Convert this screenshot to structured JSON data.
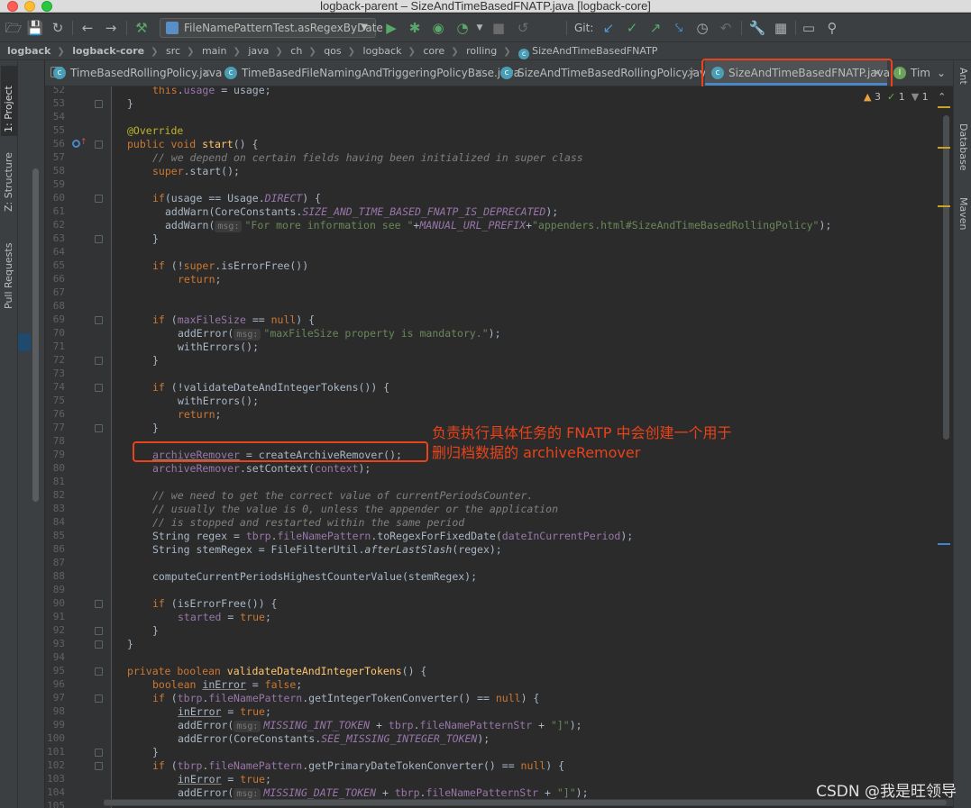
{
  "window": {
    "title": "logback-parent – SizeAndTimeBasedFNATP.java [logback-core]"
  },
  "toolbar": {
    "run_config": "FileNamePatternTest.asRegexByDate",
    "git_label": "Git:"
  },
  "breadcrumb": [
    "logback",
    "logback-core",
    "src",
    "main",
    "java",
    "ch",
    "qos",
    "logback",
    "core",
    "rolling",
    "SizeAndTimeBasedFNATP"
  ],
  "left_tools": {
    "project": "1: Project",
    "structure": "Z: Structure",
    "pull_requests": "Pull Requests"
  },
  "right_tools": {
    "ant": "Ant",
    "database": "Database",
    "maven": "Maven"
  },
  "tabs": [
    {
      "label": "TimeBasedRollingPolicy.java",
      "icon": "class-icon",
      "active": false
    },
    {
      "label": "TimeBasedFileNamingAndTriggeringPolicyBase.java",
      "icon": "class-icon",
      "active": false
    },
    {
      "label": "SizeAndTimeBasedRollingPolicy.java",
      "icon": "class-icon",
      "active": false
    },
    {
      "label": "SizeAndTimeBasedFNATP.java",
      "icon": "class-icon",
      "active": true
    },
    {
      "label": "Tim",
      "icon": "interface-icon",
      "active": false
    }
  ],
  "inspection": {
    "warnings": "3",
    "ok": "1",
    "other": "1"
  },
  "line_numbers": [
    "52",
    "53",
    "54",
    "55",
    "56",
    "57",
    "58",
    "59",
    "60",
    "61",
    "62",
    "63",
    "64",
    "65",
    "66",
    "67",
    "68",
    "69",
    "70",
    "71",
    "72",
    "73",
    "74",
    "75",
    "76",
    "77",
    "78",
    "79",
    "80",
    "81",
    "82",
    "83",
    "84",
    "85",
    "86",
    "87",
    "88",
    "89",
    "90",
    "91",
    "92",
    "93",
    "94",
    "95",
    "96",
    "97",
    "98",
    "99",
    "100",
    "101",
    "102",
    "103",
    "104",
    "105"
  ],
  "code": {
    "l52": [
      "this",
      ".",
      "usage",
      " = usage;"
    ],
    "l53": "}",
    "l55": "@Override",
    "l56": [
      "public void ",
      "start",
      "() {"
    ],
    "l57": "// we depend on certain fields having been initialized in super class",
    "l58": [
      "super",
      ".start();"
    ],
    "l60": [
      "if",
      "(usage == Usage.",
      "DIRECT",
      ") {"
    ],
    "l61": [
      "addWarn(CoreConstants.",
      "SIZE_AND_TIME_BASED_FNATP_IS_DEPRECATED",
      ");"
    ],
    "l62": [
      "addWarn(",
      "msg:",
      "\"For more information see \"",
      "+",
      "MANUAL_URL_PREFIX",
      "+",
      "\"appenders.html#SizeAndTimeBasedRollingPolicy\"",
      ");"
    ],
    "l63": "}",
    "l65": [
      "if",
      " (!",
      "super",
      ".isErrorFree())"
    ],
    "l66": [
      "return",
      ";"
    ],
    "l69": [
      "if",
      " (",
      "maxFileSize",
      " == ",
      "null",
      ") {"
    ],
    "l70": [
      "addError(",
      "msg:",
      "\"maxFileSize property is mandatory.\"",
      ");"
    ],
    "l71": "withErrors();",
    "l72": "}",
    "l74": [
      "if",
      " (!validateDateAndIntegerTokens()) {"
    ],
    "l75": "withErrors();",
    "l76": [
      "return",
      ";"
    ],
    "l77": "}",
    "l79": [
      "archiveRemover",
      " = createArchiveRemover();"
    ],
    "l80": [
      "archiveRemover",
      ".setContext(",
      "context",
      ");"
    ],
    "l82": "// we need to get the correct value of currentPeriodsCounter.",
    "l83": "// usually the value is 0, unless the appender or the application",
    "l84": "// is stopped and restarted within the same period",
    "l85": [
      "String regex = ",
      "tbrp",
      ".",
      "fileNamePattern",
      ".toRegexForFixedDate(",
      "dateInCurrentPeriod",
      ");"
    ],
    "l86": [
      "String stemRegex = FileFilterUtil.",
      "afterLastSlash",
      "(regex);"
    ],
    "l88": "computeCurrentPeriodsHighestCounterValue(stemRegex);",
    "l90": [
      "if",
      " (isErrorFree()) {"
    ],
    "l91": [
      "started",
      " = ",
      "true",
      ";"
    ],
    "l92": "}",
    "l93": "}",
    "l95": [
      "private boolean ",
      "validateDateAndIntegerTokens",
      "() {"
    ],
    "l96": [
      "boolean ",
      "inError",
      " = ",
      "false",
      ";"
    ],
    "l97": [
      "if",
      " (",
      "tbrp",
      ".",
      "fileNamePattern",
      ".getIntegerTokenConverter() == ",
      "null",
      ") {"
    ],
    "l98": [
      "inError",
      " = ",
      "true",
      ";"
    ],
    "l99": [
      "addError(",
      "msg:",
      "MISSING_INT_TOKEN",
      " + ",
      "tbrp",
      ".",
      "fileNamePatternStr",
      " + ",
      "\"]\"",
      ");"
    ],
    "l100": [
      "addError(CoreConstants.",
      "SEE_MISSING_INTEGER_TOKEN",
      ");"
    ],
    "l101": "}",
    "l102": [
      "if",
      " (",
      "tbrp",
      ".",
      "fileNamePattern",
      ".getPrimaryDateTokenConverter() == ",
      "null",
      ") {"
    ],
    "l103": [
      "inError",
      " = ",
      "true",
      ";"
    ],
    "l104": [
      "addError(",
      "msg:",
      "MISSING_DATE_TOKEN",
      " + ",
      "tbrp",
      ".",
      "fileNamePatternStr",
      " + ",
      "\"]\"",
      ");"
    ]
  },
  "annotation": {
    "line1": "负责执行具体任务的 FNATP 中会创建一个用于",
    "line2": "删归档数据的 archiveRemover"
  },
  "watermark": "CSDN @我是旺领导",
  "colors": {
    "keyword": "#cc7832",
    "string": "#6a8759",
    "comment": "#808080",
    "field": "#9876aa",
    "method": "#ffc66d",
    "annotation": "#bbb529",
    "highlight": "#e8431a"
  }
}
